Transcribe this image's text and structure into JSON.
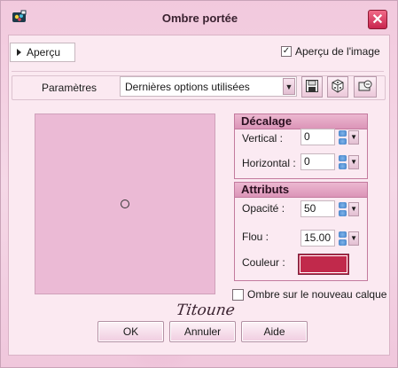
{
  "window": {
    "title": "Ombre portée",
    "close_icon": "close-icon",
    "app_icon": "paint-app-icon"
  },
  "preview": {
    "toggle_label": "Aperçu",
    "image_preview_label": "Aperçu de l'image",
    "image_preview_checked": true
  },
  "params": {
    "label": "Paramètres",
    "preset_value": "Dernières options utilisées",
    "icons": [
      "save-icon",
      "dice-icon",
      "reset-icon"
    ]
  },
  "offset": {
    "header": "Décalage",
    "vertical_label": "Vertical :",
    "vertical_value": "0",
    "horizontal_label": "Horizontal :",
    "horizontal_value": "0"
  },
  "attributes": {
    "header": "Attributs",
    "opacity_label": "Opacité :",
    "opacity_value": "50",
    "blur_label": "Flou :",
    "blur_value": "15.00",
    "color_label": "Couleur :",
    "color_hex": "#c1294b"
  },
  "new_layer": {
    "label": "Ombre sur le nouveau calque",
    "checked": false
  },
  "signature": "Titoune",
  "buttons": {
    "ok": "OK",
    "cancel": "Annuler",
    "help": "Aide"
  }
}
